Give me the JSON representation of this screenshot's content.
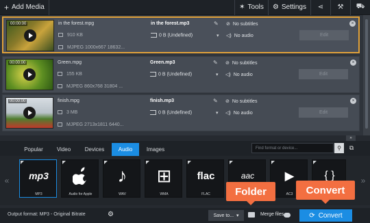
{
  "toolbar": {
    "add_media": "Add Media",
    "tools": "Tools",
    "settings": "Settings"
  },
  "files": [
    {
      "timecode": "00:00:00",
      "name": "in the forest.mpg",
      "size": "910 KB",
      "meta": "MJPEG 1000x667 18632...",
      "out_name": "in the forest.mp3",
      "out_size": "0 B (Undefined)",
      "subtitles": "No subtitles",
      "audio": "No audio",
      "edit": "Edit"
    },
    {
      "timecode": "00:00:00",
      "name": "Green.mpg",
      "size": "155 KB",
      "meta": "MJPEG 860x768 31804 ...",
      "out_name": "Green.mp3",
      "out_size": "0 B (Undefined)",
      "subtitles": "No subtitles",
      "audio": "No audio",
      "edit": "Edit"
    },
    {
      "timecode": "00:00:00",
      "name": "finish.mpg",
      "size": "3 MB",
      "meta": "MJPEG 2713x1811 6440...",
      "out_name": "finish.mp3",
      "out_size": "0 B (Undefined)",
      "subtitles": "No subtitles",
      "audio": "No audio",
      "edit": "Edit"
    }
  ],
  "tabs": [
    "Popular",
    "Video",
    "Devices",
    "Audio",
    "Images"
  ],
  "active_tab": "Audio",
  "search": {
    "placeholder": "Find format or device..."
  },
  "formats": [
    {
      "label": "MP3",
      "glyph": "mp3"
    },
    {
      "label": "Audio for Apple",
      "glyph": ""
    },
    {
      "label": "WAV",
      "glyph": "♪"
    },
    {
      "label": "WMA",
      "glyph": "⊞"
    },
    {
      "label": "FLAC",
      "glyph": "flac"
    },
    {
      "label": "",
      "glyph": "aac"
    },
    {
      "label": "AC3",
      "glyph": "▶"
    },
    {
      "label": "",
      "glyph": "{ }"
    }
  ],
  "bottom": {
    "output_format": "Output format: MP3 - Original Bitrate",
    "save_to": "Save to...",
    "merge_files": "Merge files",
    "convert": "Convert"
  },
  "callouts": {
    "folder": "Folder",
    "convert": "Convert"
  },
  "colors": {
    "accent": "#1b8de3",
    "callout": "#f36f41",
    "selected_border": "#e2a23a"
  }
}
